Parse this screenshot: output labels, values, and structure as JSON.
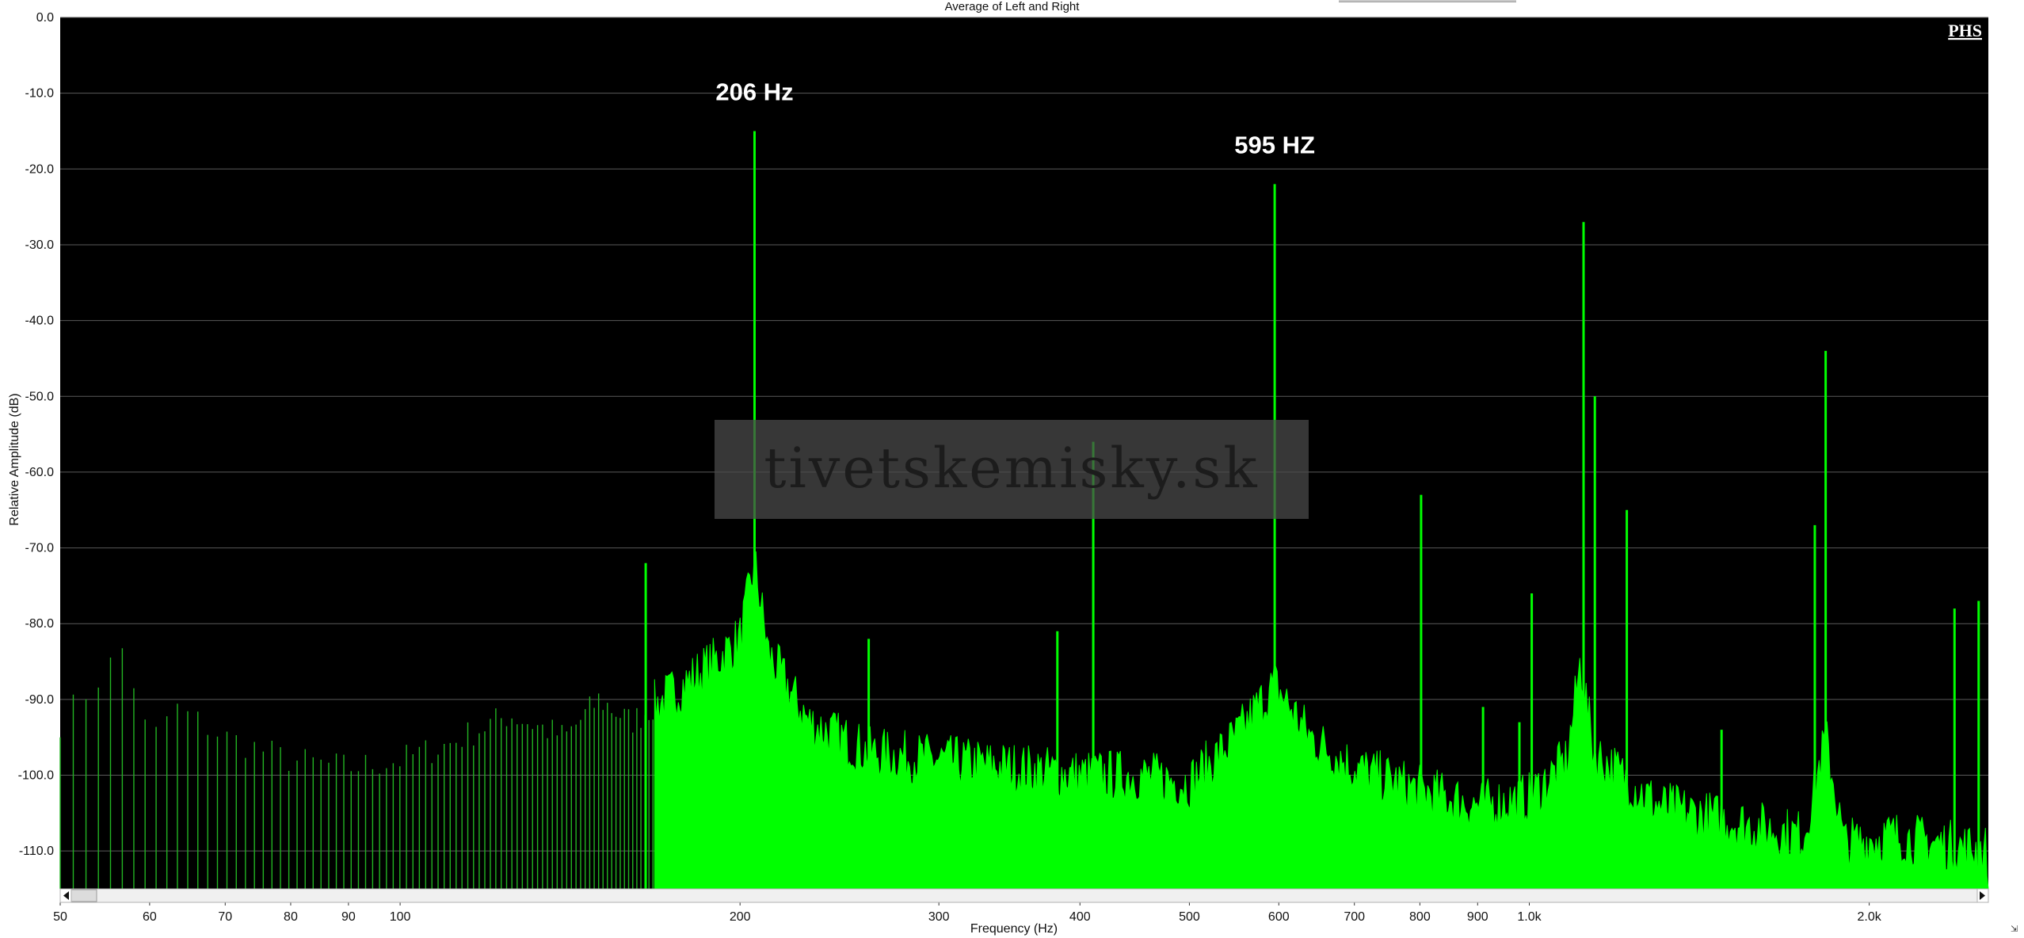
{
  "window": {
    "title": "Average of Left and Right"
  },
  "chart_data": {
    "type": "area",
    "title": "Average of Left and Right",
    "xlabel": "Frequency (Hz)",
    "ylabel": "Relative Amplitude (dB)",
    "x_scale": "log",
    "xlim": [
      50,
      2550
    ],
    "ylim": [
      -115,
      0
    ],
    "grid": true,
    "y_ticks": [
      "0.0",
      "-10.0",
      "-20.0",
      "-30.0",
      "-40.0",
      "-50.0",
      "-60.0",
      "-70.0",
      "-80.0",
      "-90.0",
      "-100.0",
      "-110.0"
    ],
    "y_tick_values": [
      0,
      -10,
      -20,
      -30,
      -40,
      -50,
      -60,
      -70,
      -80,
      -90,
      -100,
      -110
    ],
    "x_ticks": [
      "50",
      "60",
      "70",
      "80",
      "90",
      "100",
      "200",
      "300",
      "400",
      "500",
      "600",
      "700",
      "800",
      "900",
      "1.0k",
      "2.0k"
    ],
    "x_tick_values": [
      50,
      60,
      70,
      80,
      90,
      100,
      200,
      300,
      400,
      500,
      600,
      700,
      800,
      900,
      1000,
      2000
    ],
    "noise_floor_points": [
      [
        50,
        -93
      ],
      [
        55,
        -86
      ],
      [
        57,
        -83
      ],
      [
        60,
        -96
      ],
      [
        63,
        -91
      ],
      [
        70,
        -95
      ],
      [
        80,
        -98
      ],
      [
        90,
        -99
      ],
      [
        100,
        -98
      ],
      [
        110,
        -96
      ],
      [
        125,
        -92
      ],
      [
        140,
        -95
      ],
      [
        150,
        -90
      ],
      [
        160,
        -93
      ],
      [
        175,
        -89
      ],
      [
        190,
        -85
      ],
      [
        200,
        -82
      ],
      [
        206,
        -72
      ],
      [
        212,
        -84
      ],
      [
        230,
        -93
      ],
      [
        260,
        -97
      ],
      [
        300,
        -98
      ],
      [
        350,
        -99
      ],
      [
        400,
        -100
      ],
      [
        450,
        -100
      ],
      [
        500,
        -101
      ],
      [
        550,
        -95
      ],
      [
        595,
        -88
      ],
      [
        640,
        -95
      ],
      [
        700,
        -99
      ],
      [
        800,
        -102
      ],
      [
        900,
        -104
      ],
      [
        1000,
        -103
      ],
      [
        1080,
        -98
      ],
      [
        1110,
        -85
      ],
      [
        1140,
        -97
      ],
      [
        1300,
        -104
      ],
      [
        1500,
        -106
      ],
      [
        1750,
        -108
      ],
      [
        1830,
        -95
      ],
      [
        1900,
        -109
      ],
      [
        2100,
        -108
      ],
      [
        2300,
        -109
      ],
      [
        2550,
        -110
      ]
    ],
    "peaks": [
      {
        "x": 206,
        "y": -15
      },
      {
        "x": 411,
        "y": -56
      },
      {
        "x": 595,
        "y": -22
      },
      {
        "x": 802,
        "y": -63
      },
      {
        "x": 1005,
        "y": -76
      },
      {
        "x": 1117,
        "y": -27
      },
      {
        "x": 1143,
        "y": -50
      },
      {
        "x": 1220,
        "y": -65
      },
      {
        "x": 1790,
        "y": -67
      },
      {
        "x": 1830,
        "y": -44
      },
      {
        "x": 2380,
        "y": -78
      },
      {
        "x": 2500,
        "y": -77
      },
      {
        "x": 165,
        "y": -72
      },
      {
        "x": 260,
        "y": -82
      },
      {
        "x": 382,
        "y": -81
      },
      {
        "x": 910,
        "y": -91
      },
      {
        "x": 980,
        "y": -93
      },
      {
        "x": 1480,
        "y": -94
      }
    ],
    "annotations": [
      {
        "text": "206 Hz",
        "x": 206,
        "y": -13
      },
      {
        "text": "595 HZ",
        "x": 595,
        "y": -20
      }
    ]
  },
  "badge": {
    "text": "PHS"
  },
  "watermark": {
    "text": "tivetskemisky.sk"
  },
  "colors": {
    "plot_bg": "#000000",
    "trace": "#00ff00",
    "trace_dim": "#22b422",
    "grid": "#5a5a5a"
  },
  "scrollbar": {
    "left_icon": "arrow-left-icon",
    "right_icon": "arrow-right-icon"
  }
}
